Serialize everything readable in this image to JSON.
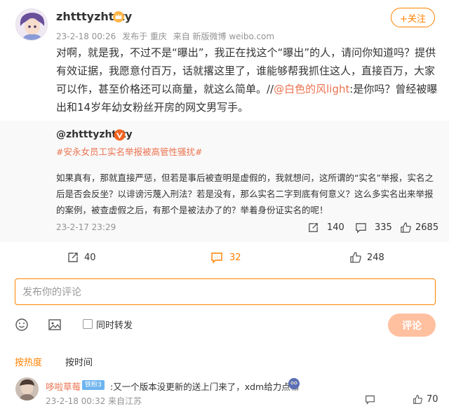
{
  "post": {
    "username": "zhtttyzhttty",
    "time": "23-2-18 00:26",
    "location": "发布于 重庆",
    "source": "来自 新版微博 weibo.com",
    "follow_label": "+关注",
    "text_part1": "对啊，就是我，不过不是“曝出”，我正在找这个“曝出”的人，请问你知道吗？提供有效证据，我愿意付百万，话就撂这里了，谁能够帮我抓住这人，直接百万，大家可以作，甚至价格还可以商量，就这么简单。//",
    "mention": "@白色的风light",
    "text_part2": ":是你吗？曾经被曝出和14岁年幼女粉丝开房的网文男写手。"
  },
  "repost": {
    "user": "@zhtttyzhttty",
    "topic": "#安永女员工实名举报被高管性骚扰#",
    "text": "如果真有，那就直接严惩，但若是事后被查明是虚假的，我就想问，这所谓的“实名”举报，实名之后是否会反坐？以诽谤污蔑入刑法？若是没有，那么实名二字到底有何意义？这么多实名出来举报的案例，被查虚假之后，有那个是被法办了的？举着身份证实名的呢！",
    "time": "23-2-17 23:29",
    "reposts": "140",
    "comments": "335",
    "likes": "2685"
  },
  "actions": {
    "reposts": "40",
    "comments": "32",
    "likes": "248"
  },
  "comment_box": {
    "placeholder": "发布你的评论",
    "repost_checkbox_label": "同时转发",
    "submit_label": "评论"
  },
  "sort": {
    "hot": "按热度",
    "time": "按时间"
  },
  "comment": {
    "name": "哆啦草莓",
    "badge": "铁粉3",
    "text": ":又一个版本没更新的送上门来了，xdm给力点嘛",
    "meta": "23-2-18 00:32 来自江苏",
    "likes": "70"
  },
  "colors": {
    "accent": "#ff8200",
    "link": "#eb7350",
    "muted": "#939393"
  }
}
